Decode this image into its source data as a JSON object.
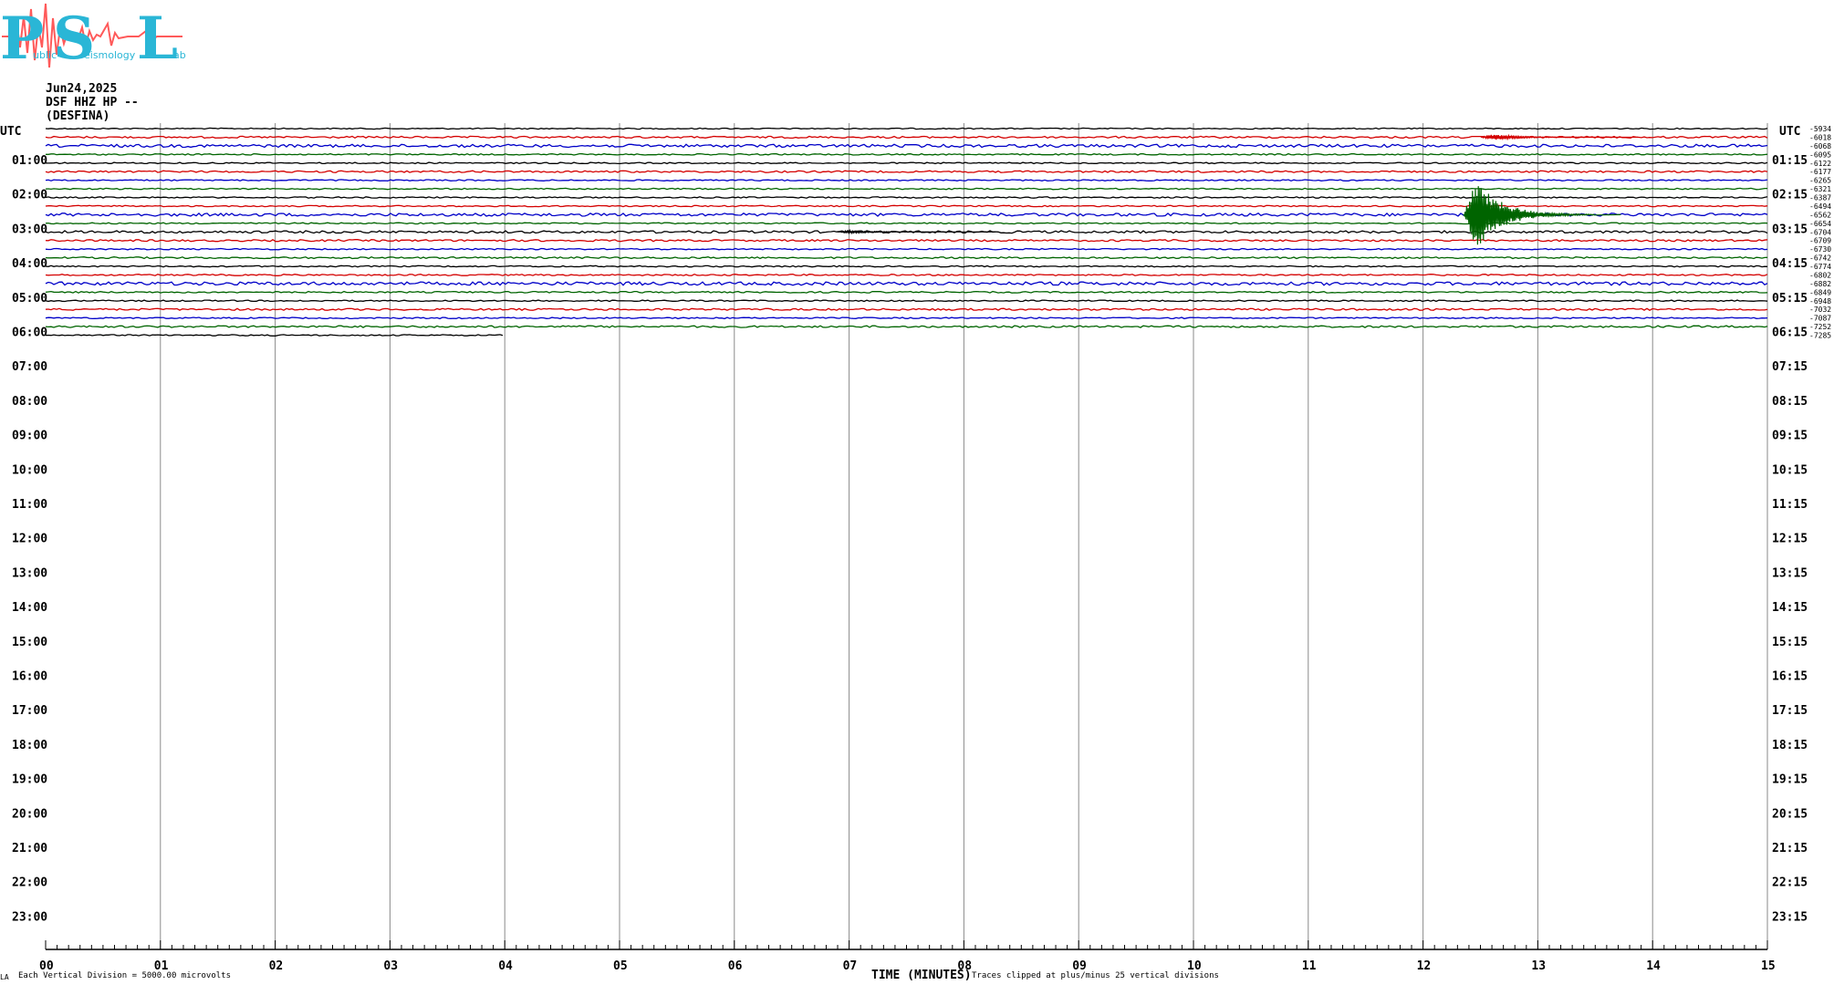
{
  "logo": {
    "letters": [
      "P",
      "S",
      "L"
    ],
    "words": [
      "ublic",
      "eismology",
      "ab"
    ],
    "colors": {
      "letters": "#2ab6d6",
      "wave": "#ff5a5a"
    }
  },
  "header": {
    "date": "Jun24,2025",
    "station": "DSF HHZ HP --",
    "name": "(DESFINA)"
  },
  "axes": {
    "utc_left": "UTC",
    "utc_right": "UTC",
    "xlabel": "TIME (MINUTES)",
    "left_hours": [
      "01:00",
      "02:00",
      "03:00",
      "04:00",
      "05:00",
      "06:00",
      "07:00",
      "08:00",
      "09:00",
      "10:00",
      "11:00",
      "12:00",
      "13:00",
      "14:00",
      "15:00",
      "16:00",
      "17:00",
      "18:00",
      "19:00",
      "20:00",
      "21:00",
      "22:00",
      "23:00"
    ],
    "right_hours": [
      "01:15",
      "02:15",
      "03:15",
      "04:15",
      "05:15",
      "06:15",
      "07:15",
      "08:15",
      "09:15",
      "10:15",
      "11:15",
      "12:15",
      "13:15",
      "14:15",
      "15:15",
      "16:15",
      "17:15",
      "18:15",
      "19:15",
      "20:15",
      "21:15",
      "22:15",
      "23:15"
    ],
    "minute_ticks": [
      "00",
      "01",
      "02",
      "03",
      "04",
      "05",
      "06",
      "07",
      "08",
      "09",
      "10",
      "11",
      "12",
      "13",
      "14",
      "15"
    ]
  },
  "footer": {
    "left_mark": "LA",
    "scale_note": "Each Vertical Division = 5000.00 microvolts",
    "clip_note": "Traces clipped at plus/minus 25 vertical divisions"
  },
  "chart_data": {
    "type": "line",
    "title": "",
    "xlabel": "TIME (MINUTES)",
    "ylabel": "UTC",
    "xlim": [
      0,
      15
    ],
    "rows_per_hour": 4,
    "row_minutes": 15,
    "trace_color_cycle": [
      "#000000",
      "#d40000",
      "#0000c8",
      "#006400"
    ],
    "partial_last_row": {
      "start": "06:00",
      "end_minute": 4.0
    },
    "row_offsets": [
      "-5934",
      "-6018",
      "-6068",
      "-6095",
      "-6122",
      "-6177",
      "-6265",
      "-6321",
      "-6387",
      "-6494",
      "-6562",
      "-6654",
      "-6704",
      "-6709",
      "-6730",
      "-6742",
      "-6774",
      "-6802",
      "-6882",
      "-6849",
      "-6948",
      "-7032",
      "-7087",
      "-7252",
      "-7285"
    ],
    "events": [
      {
        "row_start": "02:30",
        "minute": 12.45,
        "peak_divisions": 25,
        "description_color": "#006400"
      },
      {
        "row_start": "00:15",
        "minute": 12.6,
        "peak_divisions": 2,
        "description_color": "#d40000"
      },
      {
        "row_start": "03:00",
        "minute": 7.0,
        "peak_divisions": 1,
        "description_color": "#000000"
      }
    ],
    "grid": true,
    "scale": "Each Vertical Division = 5000.00 microvolts"
  }
}
